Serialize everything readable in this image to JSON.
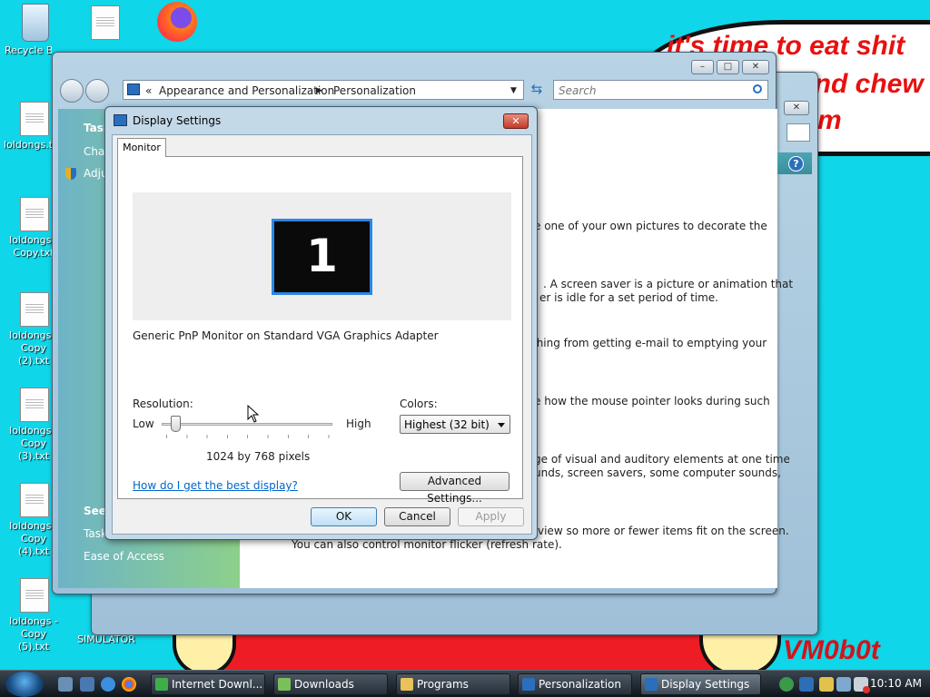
{
  "wallpaper": {
    "speech_line1": "it's time to eat shit",
    "speech_line2": "and chew",
    "speech_line3": "m",
    "signature": "VM0b0t"
  },
  "desktop_icons": [
    {
      "label": "Recycle Bin"
    },
    {
      "label": "loldongs.txt"
    },
    {
      "label": "loldongs - Copy.txt"
    },
    {
      "label": "loldongs - Copy (2).txt"
    },
    {
      "label": "loldongs - Copy (3).txt"
    },
    {
      "label": "loldongs - Copy (4).txt"
    },
    {
      "label": "loldongs - Copy (5).txt"
    },
    {
      "label": "B SIMULATOR"
    }
  ],
  "explorer": {
    "breadcrumb_prefix": "«",
    "breadcrumb_1": "Appearance and Personalization",
    "breadcrumb_2": "Personalization",
    "search_placeholder": "Search",
    "sidebar": {
      "tasks": "Task",
      "change": "Cha",
      "adjust": "Adju",
      "see_also": "See",
      "taskbar": "Task",
      "ease_of_access": "Ease of Access"
    },
    "content": [
      {
        "text": "e one of your own pictures to decorate the"
      },
      {
        "text": ". A screen saver is a picture or animation that"
      },
      {
        "text": "er is idle for a set period of time."
      },
      {
        "text": "thing from getting e-mail to emptying your"
      },
      {
        "text": "e how the mouse pointer looks during such"
      },
      {
        "text": "ge of visual and auditory elements at one time"
      },
      {
        "text": "unds, screen savers, some computer sounds,"
      },
      {
        "text": "view so more or fewer items fit on the screen."
      },
      {
        "text": "You can also control monitor flicker (refresh rate)."
      }
    ]
  },
  "dialog": {
    "title": "Display Settings",
    "close_glyph": "✕",
    "tab_monitor": "Monitor",
    "monitor_number": "1",
    "monitor_name": "Generic PnP Monitor on Standard VGA Graphics Adapter",
    "resolution_label": "Resolution:",
    "low_label": "Low",
    "high_label": "High",
    "resolution_value": "1024 by 768 pixels",
    "resolution_level": 0.08,
    "colors_label": "Colors:",
    "colors_value": "Highest (32 bit)",
    "help_link": "How do I get the best display?",
    "advanced_button": "Advanced Settings...",
    "ok_button": "OK",
    "cancel_button": "Cancel",
    "apply_button": "Apply"
  },
  "taskbar": {
    "items": [
      {
        "label": "Internet Downl..."
      },
      {
        "label": "Downloads"
      },
      {
        "label": "Programs"
      },
      {
        "label": "Personalization"
      },
      {
        "label": "Display Settings"
      }
    ],
    "clock": "10:10 AM"
  },
  "colors": {
    "desktop": "#0fd6e9",
    "accent_blue": "#2b86e6",
    "link": "#0066cc"
  }
}
